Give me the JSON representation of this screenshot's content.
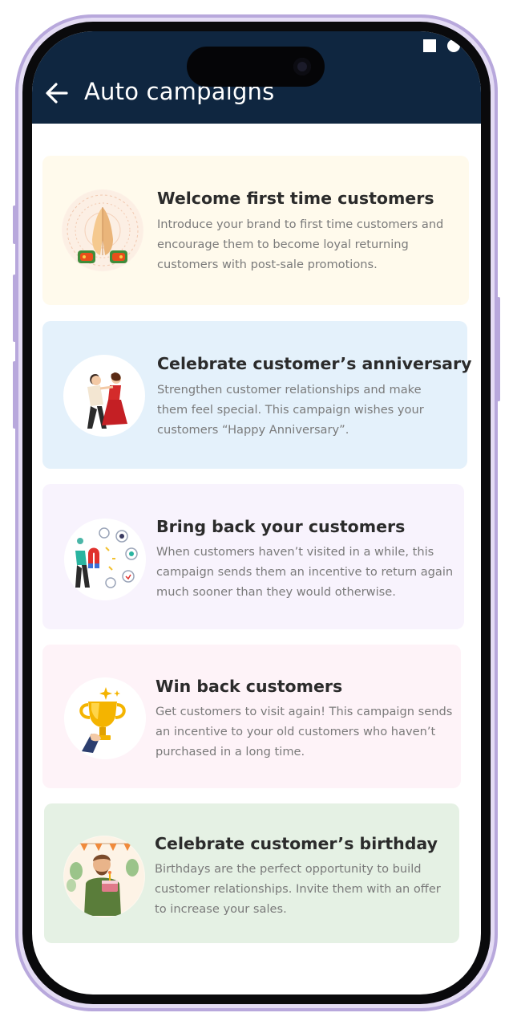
{
  "header": {
    "title": "Auto campaigns",
    "back_icon": "arrow-left-icon",
    "background": "#0f2640"
  },
  "status_bar": {
    "icons": [
      "square-icon",
      "circle-icon"
    ]
  },
  "campaigns": [
    {
      "title": "Welcome first time customers",
      "description": "Introduce your brand to first time customers and encourage them to become loyal returning customers with post-sale promotions.",
      "icon": "namaste-hands-icon",
      "background": "#fffaec"
    },
    {
      "title": "Celebrate customer’s anniversary",
      "description": "Strengthen customer relationships and make them feel special. This campaign wishes your customers “Happy Anniversary”.",
      "icon": "dancing-couple-icon",
      "background": "#e4f1fb"
    },
    {
      "title": "Bring back your customers",
      "description": "When customers haven’t visited in a while, this campaign sends them an incentive to return again much sooner than they would otherwise.",
      "icon": "magnet-customers-icon",
      "background": "#f8f3fd"
    },
    {
      "title": "Win back customers",
      "description": "Get customers to visit again! This campaign sends an incentive to your old customers who haven’t purchased in a long time.",
      "icon": "trophy-icon",
      "background": "#fef3f8"
    },
    {
      "title": "Celebrate customer’s birthday",
      "description": "Birthdays are the perfect opportunity to build customer relationships. Invite them with an offer to increase your sales.",
      "icon": "birthday-cake-icon",
      "background": "#e5f1e4"
    }
  ]
}
